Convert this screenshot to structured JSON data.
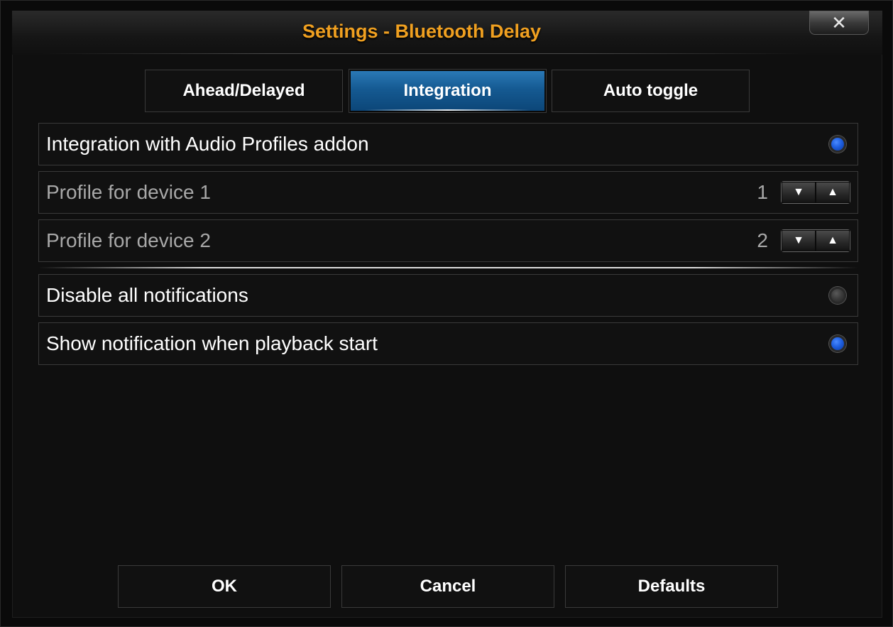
{
  "dialog": {
    "title": "Settings - Bluetooth Delay",
    "close_label": "✕"
  },
  "tabs": [
    {
      "label": "Ahead/Delayed",
      "active": false
    },
    {
      "label": "Integration",
      "active": true
    },
    {
      "label": "Auto toggle",
      "active": false
    }
  ],
  "settings": [
    {
      "label": "Integration with Audio Profiles addon",
      "type": "radio",
      "checked": true
    },
    {
      "label": "Profile for device 1",
      "type": "spinner",
      "value": "1"
    },
    {
      "label": "Profile for device 2",
      "type": "spinner",
      "value": "2"
    },
    {
      "label": "Disable all notifications",
      "type": "radio",
      "checked": false
    },
    {
      "label": "Show notification when playback start",
      "type": "radio",
      "checked": true
    }
  ],
  "spinner_icons": {
    "down": "▼",
    "up": "▲"
  },
  "footer": {
    "ok_label": "OK",
    "cancel_label": "Cancel",
    "defaults_label": "Defaults"
  },
  "colors": {
    "title": "#f0a020",
    "active_tab": "#155a92",
    "radio_on": "#1f5fe0",
    "radio_off": "#3a3a3a"
  }
}
